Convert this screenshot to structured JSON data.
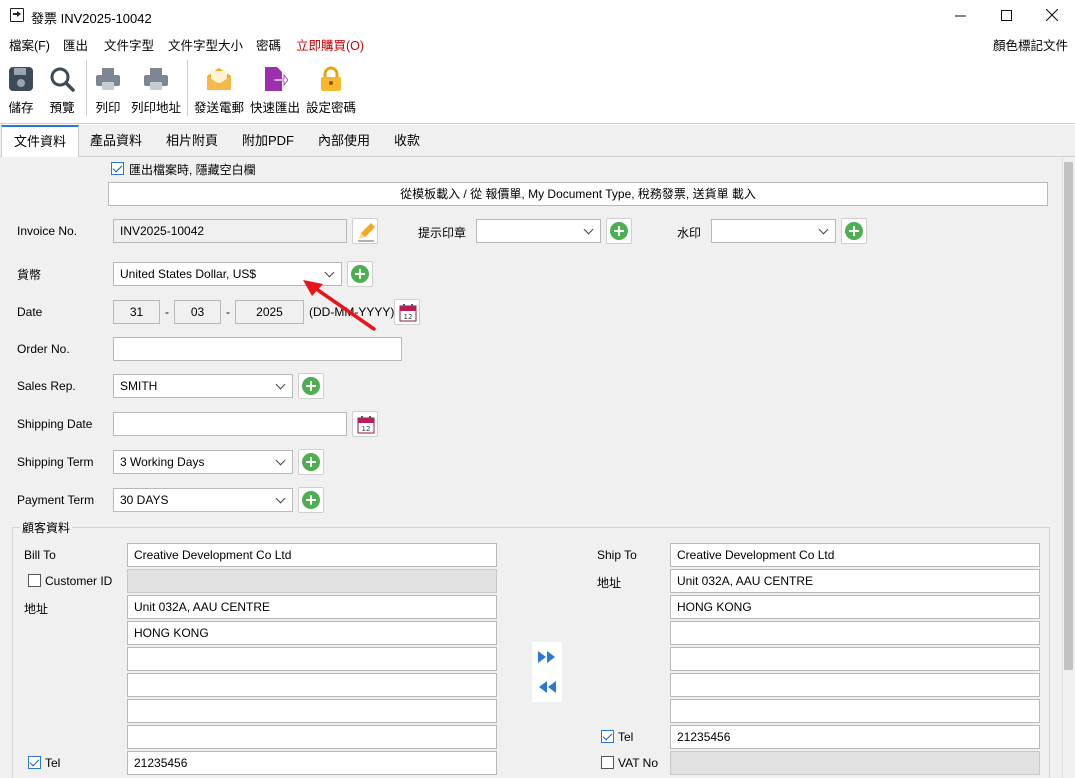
{
  "window": {
    "title": "發票 INV2025-10042"
  },
  "menu": {
    "items": [
      "檔案(F)",
      "匯出",
      "文件字型",
      "文件字型大小",
      "密碼",
      "立即購買(O)"
    ],
    "right_item": "顏色標記文件",
    "highlight_color": "#cc0000"
  },
  "toolbar": {
    "save": "儲存",
    "preview": "預覽",
    "print": "列印",
    "print_address": "列印地址",
    "send_email": "發送電郵",
    "quick_export": "快速匯出",
    "set_password": "設定密碼"
  },
  "tabs": [
    "文件資料",
    "產品資料",
    "相片附頁",
    "附加PDF",
    "內部使用",
    "收款"
  ],
  "active_tab": "文件資料",
  "form": {
    "hide_blank_label": "匯出檔案時, 隱藏空白欄",
    "hide_blank_checked": true,
    "load_template_button": "從模板載入 / 從 報價單, My Document Type, 稅務發票, 送貨單 載入",
    "invoice_no_label": "Invoice No.",
    "invoice_no_value": "INV2025-10042",
    "stamp_label": "提示印章",
    "stamp_value": "",
    "watermark_label": "水印",
    "watermark_value": "",
    "currency_label": "貨幣",
    "currency_value": "United States Dollar, US$",
    "date_label": "Date",
    "date_day": "31",
    "date_month": "03",
    "date_year": "2025",
    "date_sep": "-",
    "date_format": "(DD-MM-YYYY)",
    "order_no_label": "Order No.",
    "order_no_value": "",
    "sales_rep_label": "Sales Rep.",
    "sales_rep_value": "SMITH",
    "shipping_date_label": "Shipping Date",
    "shipping_date_value": "",
    "shipping_term_label": "Shipping Term",
    "shipping_term_value": "3 Working Days",
    "payment_term_label": "Payment Term",
    "payment_term_value": "30 DAYS"
  },
  "customer": {
    "group_title": "顧客資料",
    "bill_to_label": "Bill To",
    "bill_to_value": "Creative Development Co Ltd",
    "customer_id_label": "Customer ID",
    "customer_id_checked": false,
    "bill_address_label": "地址",
    "bill_address": [
      "Unit 032A, AAU CENTRE",
      "HONG KONG",
      "",
      "",
      "",
      ""
    ],
    "bill_tel_label": "Tel",
    "bill_tel_checked": true,
    "bill_tel_value": "21235456",
    "ship_to_label": "Ship To",
    "ship_to_value": "Creative Development Co Ltd",
    "ship_address_label": "地址",
    "ship_address": [
      "Unit 032A, AAU CENTRE",
      "HONG KONG",
      "",
      "",
      "",
      ""
    ],
    "ship_tel_label": "Tel",
    "ship_tel_checked": true,
    "ship_tel_value": "21235456",
    "vat_label": "VAT No",
    "vat_checked": false
  }
}
